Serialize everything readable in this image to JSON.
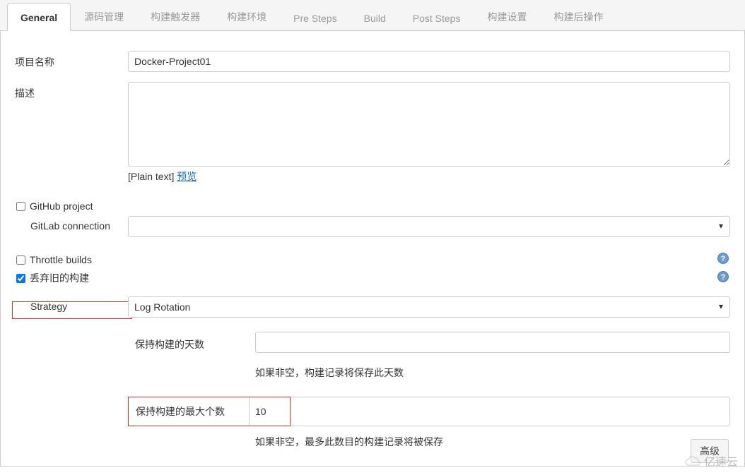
{
  "tabs": [
    {
      "label": "General",
      "active": true
    },
    {
      "label": "源码管理"
    },
    {
      "label": "构建触发器"
    },
    {
      "label": "构建环境"
    },
    {
      "label": "Pre Steps"
    },
    {
      "label": "Build"
    },
    {
      "label": "Post Steps"
    },
    {
      "label": "构建设置"
    },
    {
      "label": "构建后操作"
    }
  ],
  "labels": {
    "project_name": "项目名称",
    "description": "描述",
    "plain_text": "[Plain text]",
    "preview": "预览",
    "github_project": "GitHub project",
    "gitlab_connection": "GitLab connection",
    "throttle_builds": "Throttle builds",
    "discard_old": "丢弃旧的构建",
    "strategy": "Strategy",
    "keep_days": "保持构建的天数",
    "keep_days_hint": "如果非空，构建记录将保存此天数",
    "keep_max": "保持构建的最大个数",
    "keep_max_hint": "如果非空，最多此数目的构建记录将被保存",
    "advanced": "高级",
    "help": "?"
  },
  "values": {
    "project_name": "Docker-Project01",
    "description": "",
    "gitlab_connection": "",
    "github_project_checked": false,
    "throttle_checked": false,
    "discard_checked": true,
    "strategy": "Log Rotation",
    "keep_days": "",
    "keep_max": "10"
  },
  "watermark": "亿速云"
}
